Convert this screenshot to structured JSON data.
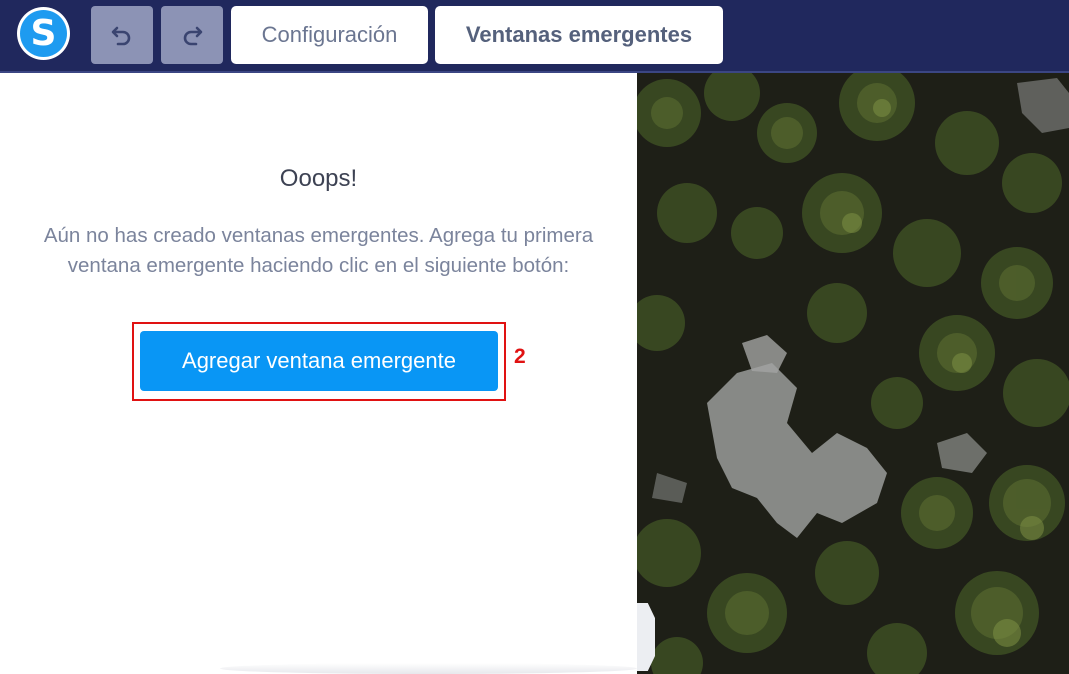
{
  "topbar": {
    "logo_letter": "S",
    "undo_icon": "undo-icon",
    "redo_icon": "redo-icon",
    "tabs": [
      {
        "label": "Configuración",
        "active": false
      },
      {
        "label": "Ventanas emergentes",
        "active": true
      }
    ]
  },
  "empty_state": {
    "title": "Ooops!",
    "line1": "Aún no has creado ventanas emergentes. Agrega tu primera",
    "line2": "ventana emergente haciendo clic en el siguiente botón:",
    "button_label": "Agregar ventana emergente",
    "annotation_marker": "2"
  },
  "colors": {
    "topbar_bg": "#20285d",
    "accent": "#0996f5",
    "annotation": "#e01212"
  }
}
